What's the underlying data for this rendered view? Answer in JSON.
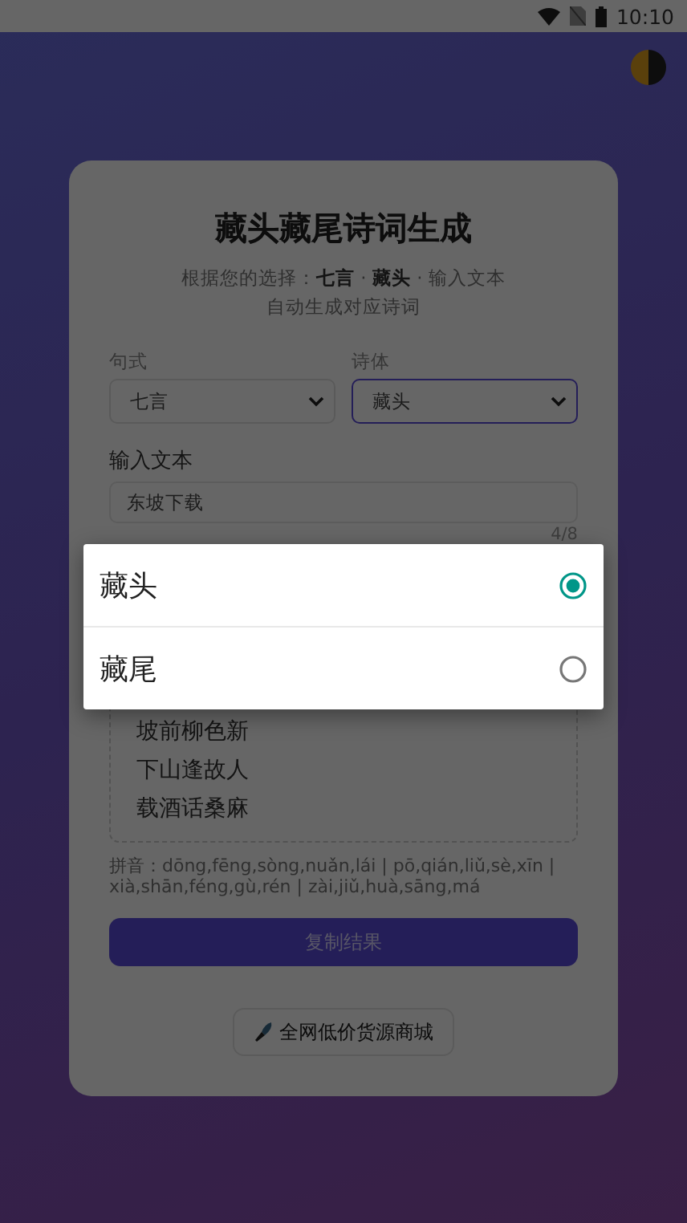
{
  "status_bar": {
    "time": "10:10"
  },
  "card": {
    "title": "藏头藏尾诗词生成",
    "subtitle": "根据您的选择：**七言** · **藏头** · 输入文本",
    "subtitle_2": "自动生成对应诗词",
    "fields": [
      {
        "label": "句式",
        "value": "七言",
        "focused": false
      },
      {
        "label": "诗体",
        "value": "藏头",
        "focused": true
      }
    ],
    "input": {
      "label": "输入文本",
      "value": "东坡下载",
      "counter": "4/8"
    },
    "poem_lines": [
      "坡前柳色新",
      "下山逢故人",
      "载酒话桑麻"
    ],
    "pinyin": "拼音：dōng,fēng,sòng,nuǎn,lái | pō,qián,liǔ,sè,xīn | xià,shān,féng,gù,rén | zài,jiǔ,huà,sāng,má",
    "copy_button": "复制结果",
    "store_button": "全网低价货源商城"
  },
  "dropdown": {
    "options": [
      {
        "label": "藏头",
        "selected": true
      },
      {
        "label": "藏尾",
        "selected": false
      }
    ]
  }
}
